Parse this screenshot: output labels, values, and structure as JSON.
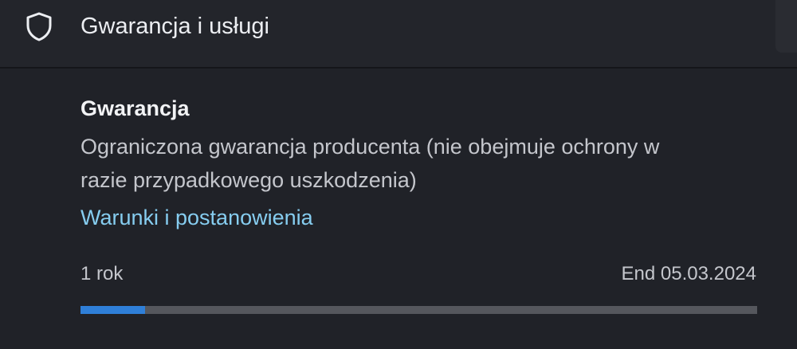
{
  "header": {
    "icon": "shield-icon",
    "title": "Gwarancja i usługi"
  },
  "warranty": {
    "title": "Gwarancja",
    "description": "Ograniczona gwarancja producenta (nie obejmuje ochrony w razie przypadkowego uszkodzenia)",
    "terms_link": "Warunki i postanowienia",
    "duration": "1 rok",
    "end_date": "End 05.03.2024",
    "progress_fraction": 0.095
  },
  "colors": {
    "background": "#202228",
    "link": "#86cdf0",
    "progress_fill": "#2f7fd8",
    "progress_track": "#55575d"
  }
}
